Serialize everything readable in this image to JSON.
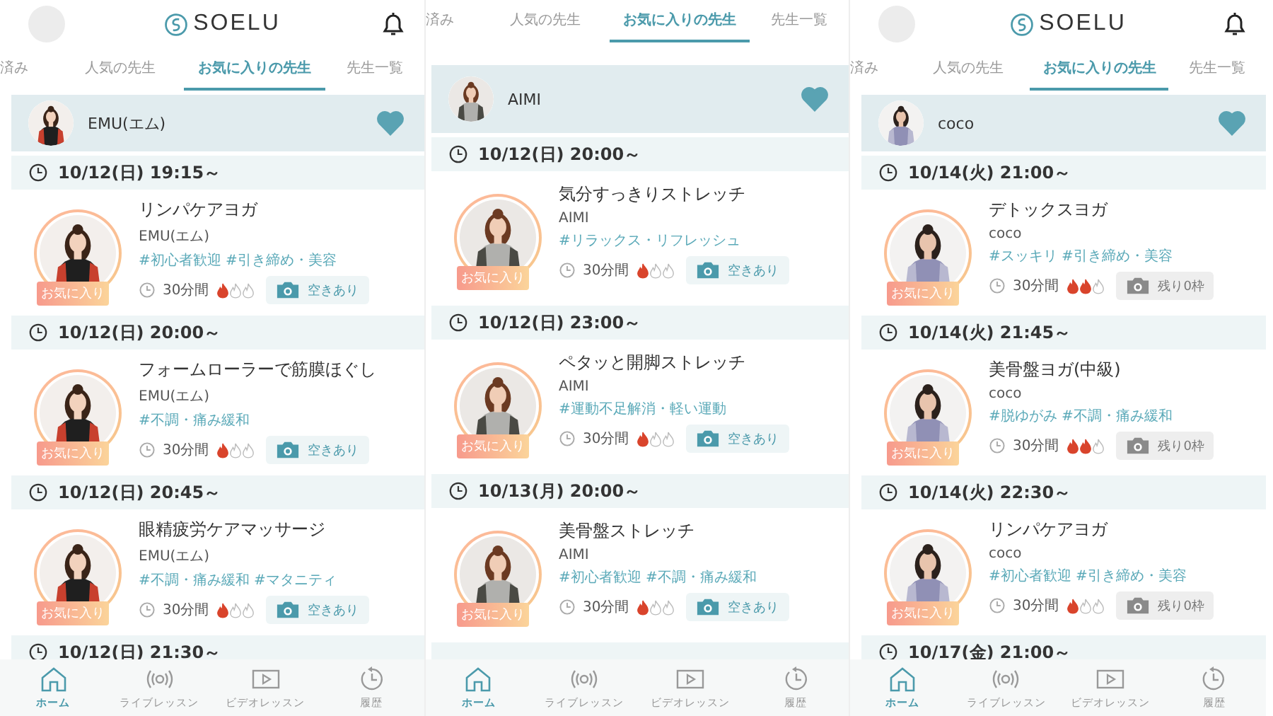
{
  "screens": [
    {
      "header": {
        "logo": "SOELU"
      },
      "tabs": [
        {
          "label": "済み",
          "selected": false
        },
        {
          "label": "人気の先生",
          "selected": false
        },
        {
          "label": "お気に入りの先生",
          "selected": true
        },
        {
          "label": "先生一覧",
          "selected": false
        }
      ],
      "teacher": {
        "name": "EMU(エム)",
        "favorite": true
      },
      "slots": [
        {
          "time": "10/12(日) 19:15～",
          "lesson": {
            "title": "リンパケアヨガ",
            "teacher": "EMU(エム)",
            "tags": "#初心者歓迎 #引き締め・美容",
            "badge": "お気に入り",
            "duration": "30分間",
            "stars": 1,
            "availability": {
              "label": "空きあり",
              "available": true
            }
          }
        },
        {
          "time": "10/12(日) 20:00～",
          "lesson": {
            "title": "フォームローラーで筋膜ほぐし",
            "teacher": "EMU(エム)",
            "tags": "#不調・痛み緩和",
            "badge": "お気に入り",
            "duration": "30分間",
            "stars": 1,
            "availability": {
              "label": "空きあり",
              "available": true
            }
          }
        },
        {
          "time": "10/12(日) 20:45～",
          "lesson": {
            "title": "眼精疲労ケアマッサージ",
            "teacher": "EMU(エム)",
            "tags": "#不調・痛み緩和 #マタニティ",
            "badge": "お気に入り",
            "duration": "30分間",
            "stars": 1,
            "availability": {
              "label": "空きあり",
              "available": true
            }
          }
        },
        {
          "time": "10/12(日) 21:30～"
        }
      ],
      "nav": [
        {
          "label": "ホーム",
          "selected": true
        },
        {
          "label": "ライブレッスン",
          "selected": false
        },
        {
          "label": "ビデオレッスン",
          "selected": false
        },
        {
          "label": "履歴",
          "selected": false
        }
      ]
    },
    {
      "tabs": [
        {
          "label": "済み",
          "selected": false
        },
        {
          "label": "人気の先生",
          "selected": false
        },
        {
          "label": "お気に入りの先生",
          "selected": true
        },
        {
          "label": "先生一覧",
          "selected": false
        }
      ],
      "teacher": {
        "name": "AIMI",
        "favorite": true
      },
      "slots": [
        {
          "time": "10/12(日) 20:00～",
          "lesson": {
            "title": "気分すっきりストレッチ",
            "teacher": "AIMI",
            "tags": "#リラックス・リフレッシュ",
            "badge": "お気に入り",
            "duration": "30分間",
            "stars": 1,
            "availability": {
              "label": "空きあり",
              "available": true
            }
          }
        },
        {
          "time": "10/12(日) 23:00～",
          "lesson": {
            "title": "ペタッと開脚ストレッチ",
            "teacher": "AIMI",
            "tags": "#運動不足解消・軽い運動",
            "badge": "お気に入り",
            "duration": "30分間",
            "stars": 1,
            "availability": {
              "label": "空きあり",
              "available": true
            }
          }
        },
        {
          "time": "10/13(月) 20:00～",
          "lesson": {
            "title": "美骨盤ストレッチ",
            "teacher": "AIMI",
            "tags": "#初心者歓迎 #不調・痛み緩和",
            "badge": "お気に入り",
            "duration": "30分間",
            "stars": 1,
            "availability": {
              "label": "空きあり",
              "available": true
            }
          }
        },
        {
          "kind": "cut-off"
        }
      ],
      "nav": [
        {
          "label": "ホーム",
          "selected": true
        },
        {
          "label": "ライブレッスン",
          "selected": false
        },
        {
          "label": "ビデオレッスン",
          "selected": false
        },
        {
          "label": "履歴",
          "selected": false
        }
      ]
    },
    {
      "header": {
        "logo": "SOELU"
      },
      "tabs": [
        {
          "label": "済み",
          "selected": false
        },
        {
          "label": "人気の先生",
          "selected": false
        },
        {
          "label": "お気に入りの先生",
          "selected": true
        },
        {
          "label": "先生一覧",
          "selected": false
        }
      ],
      "teacher": {
        "name": "coco",
        "favorite": true
      },
      "slots": [
        {
          "time": "10/14(火) 21:00～",
          "lesson": {
            "title": "デトックスヨガ",
            "teacher": "coco",
            "tags": "#スッキリ #引き締め・美容",
            "badge": "お気に入り",
            "duration": "30分間",
            "stars": 2,
            "availability": {
              "label": "残り0枠",
              "available": false
            }
          }
        },
        {
          "time": "10/14(火) 21:45～",
          "lesson": {
            "title": "美骨盤ヨガ(中級)",
            "teacher": "coco",
            "tags": "#脱ゆがみ #不調・痛み緩和",
            "badge": "お気に入り",
            "duration": "30分間",
            "stars": 2,
            "availability": {
              "label": "残り0枠",
              "available": false
            }
          }
        },
        {
          "time": "10/14(火) 22:30～",
          "lesson": {
            "title": "リンパケアヨガ",
            "teacher": "coco",
            "tags": "#初心者歓迎 #引き締め・美容",
            "badge": "お気に入り",
            "duration": "30分間",
            "stars": 1,
            "availability": {
              "label": "残り0枠",
              "available": false
            }
          }
        },
        {
          "time": "10/17(金) 21:00～"
        }
      ],
      "nav": [
        {
          "label": "ホーム",
          "selected": true
        },
        {
          "label": "ライブレッスン",
          "selected": false
        },
        {
          "label": "ビデオレッスン",
          "selected": false
        },
        {
          "label": "履歴",
          "selected": false
        }
      ]
    }
  ]
}
